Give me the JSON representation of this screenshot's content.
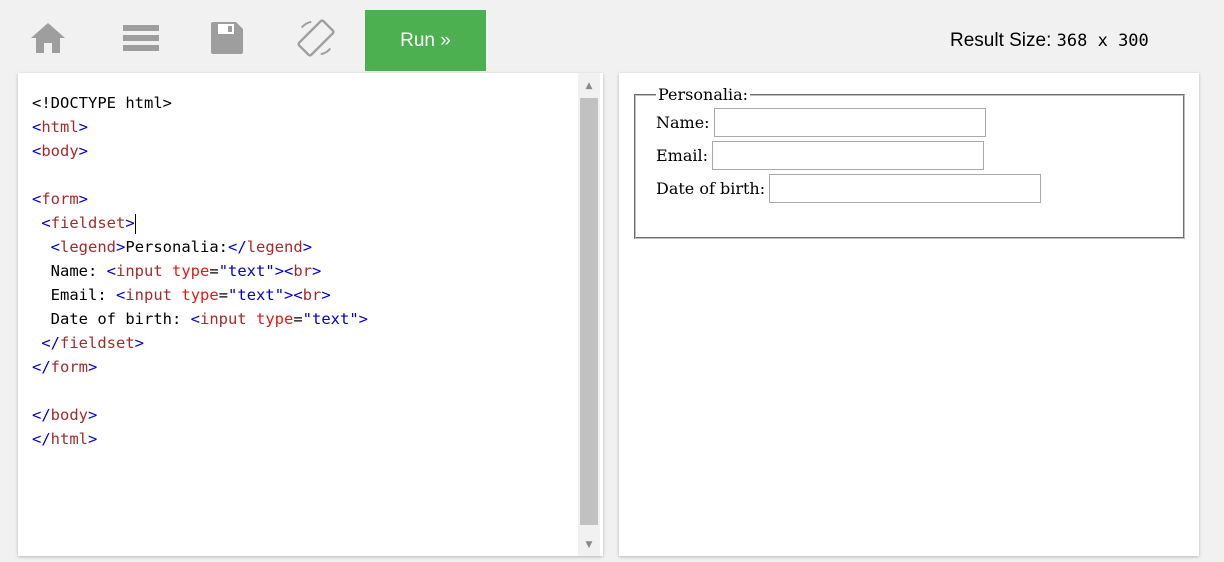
{
  "toolbar": {
    "home_icon": "home-icon",
    "menu_icon": "menu-icon",
    "save_icon": "save-icon",
    "rotate_icon": "rotate-icon",
    "run_label": "Run »",
    "result_size_label": "Result Size:",
    "result_size_value": "368 x 300"
  },
  "editor": {
    "lines": [
      "<!DOCTYPE html>",
      "<html>",
      "<body>",
      "",
      "<form>",
      " <fieldset>",
      "  <legend>Personalia:</legend>",
      "  Name: <input type=\"text\"><br>",
      "  Email: <input type=\"text\"><br>",
      "  Date of birth: <input type=\"text\">",
      " </fieldset>",
      "</form>",
      "",
      "</body>",
      "</html>"
    ]
  },
  "result": {
    "legend": "Personalia:",
    "fields": [
      {
        "label": "Name:"
      },
      {
        "label": "Email:"
      },
      {
        "label": "Date of birth:"
      }
    ]
  },
  "colors": {
    "run_button": "#4caf50",
    "tag": "#a52a2a",
    "bracket": "#0000cd",
    "attr": "#e41b17",
    "value": "#0000cd",
    "toolbar_icon": "#9e9e9e"
  }
}
